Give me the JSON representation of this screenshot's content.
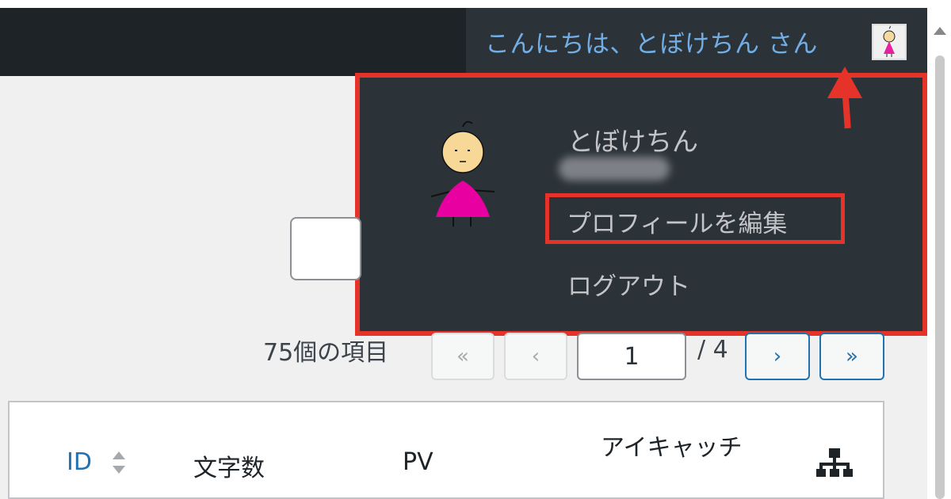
{
  "admin_bar": {
    "greeting": "こんにちは、とぼけちん さん",
    "avatar_icon": "user-avatar-icon"
  },
  "profile_menu": {
    "display_name": "とぼけちん",
    "edit_profile": "プロフィールを編集",
    "logout": "ログアウト"
  },
  "pagination": {
    "item_count": "75個の項目",
    "first": "«",
    "prev": "‹",
    "current_page": "1",
    "total": "/ 4",
    "next": "›",
    "last": "»"
  },
  "table": {
    "columns": [
      "ID",
      "文字数",
      "PV",
      "アイキャッチ"
    ],
    "hierarchy_icon": "sitemap-icon"
  },
  "colors": {
    "admin_bar_bg": "#1d2327",
    "menu_bg": "#2c3338",
    "link_blue": "#72aee6",
    "highlight_red": "#e5332a",
    "primary_blue": "#2271b1"
  }
}
